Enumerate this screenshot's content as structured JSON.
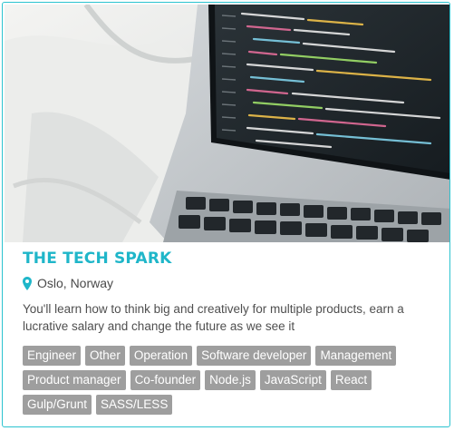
{
  "card": {
    "image_alt": "laptop-with-code",
    "title": "THE TECH SPARK",
    "location": "Oslo, Norway",
    "location_icon": "map-pin-icon",
    "description": "You'll learn how to think big and creatively for multiple products, earn a lucrative salary and change the future as we see it",
    "tags": [
      "Engineer",
      "Other",
      "Operation",
      "Software developer",
      "Management",
      "Product manager",
      "Co-founder",
      "Node.js",
      "JavaScript",
      "React",
      "Gulp/Grunt",
      "SASS/LESS"
    ]
  },
  "colors": {
    "accent": "#1fb6c9",
    "border": "#2bc3cf",
    "tag_bg": "#9e9e9e",
    "tag_text": "#ffffff"
  }
}
